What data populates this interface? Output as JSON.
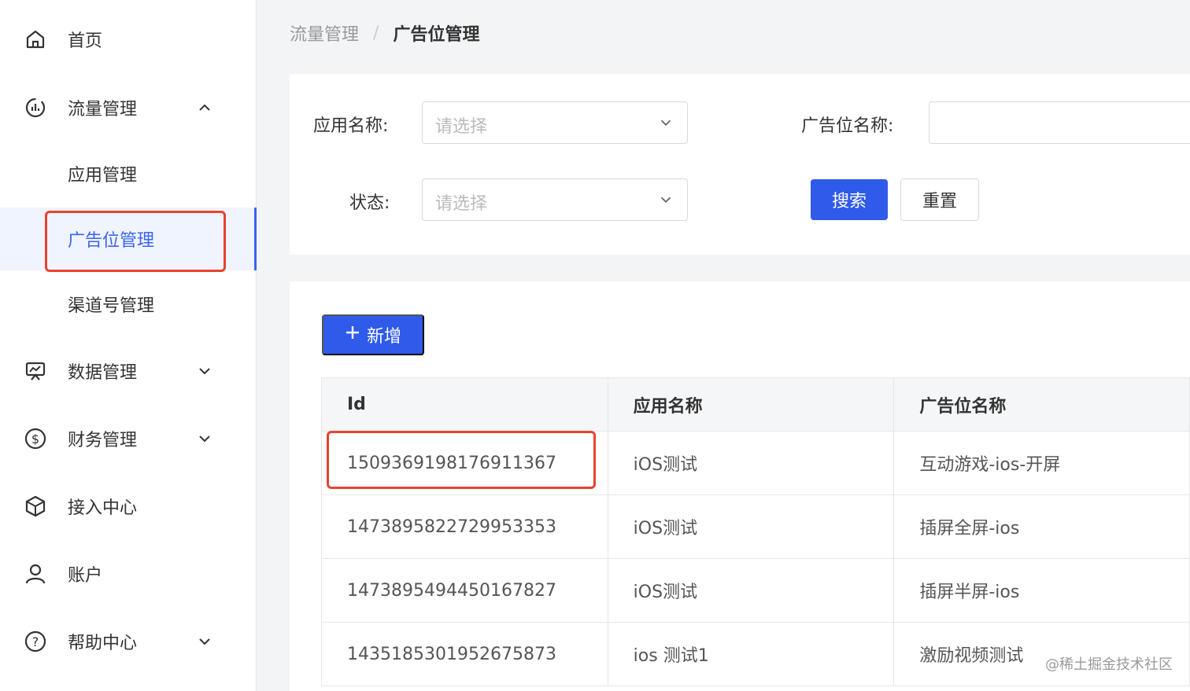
{
  "sidebar": {
    "home": "首页",
    "traffic": "流量管理",
    "traffic_sub": [
      "应用管理",
      "广告位管理",
      "渠道号管理"
    ],
    "data": "数据管理",
    "finance": "财务管理",
    "access": "接入中心",
    "account": "账户",
    "help": "帮助中心"
  },
  "breadcrumb": {
    "parent": "流量管理",
    "separator": "/",
    "current": "广告位管理"
  },
  "filters": {
    "app_label": "应用名称:",
    "app_placeholder": "请选择",
    "slot_label": "广告位名称:",
    "status_label": "状态:",
    "status_placeholder": "请选择",
    "search_button": "搜索",
    "reset_button": "重置"
  },
  "toolbar": {
    "add_label": "新增"
  },
  "table": {
    "columns": [
      "Id",
      "应用名称",
      "广告位名称"
    ],
    "rows": [
      [
        "1509369198176911367",
        "iOS测试",
        "互动游戏-ios-开屏"
      ],
      [
        "1473895822729953353",
        "iOS测试",
        "插屏全屏-ios"
      ],
      [
        "1473895494450167827",
        "iOS测试",
        "插屏半屏-ios"
      ],
      [
        "1435185301952675873",
        "ios 测试1",
        "激励视频测试"
      ]
    ]
  },
  "watermark": "@稀土掘金技术社区",
  "colors": {
    "primary": "#2f5aea",
    "highlight": "#e8432e",
    "active_text": "#3b63f0"
  }
}
